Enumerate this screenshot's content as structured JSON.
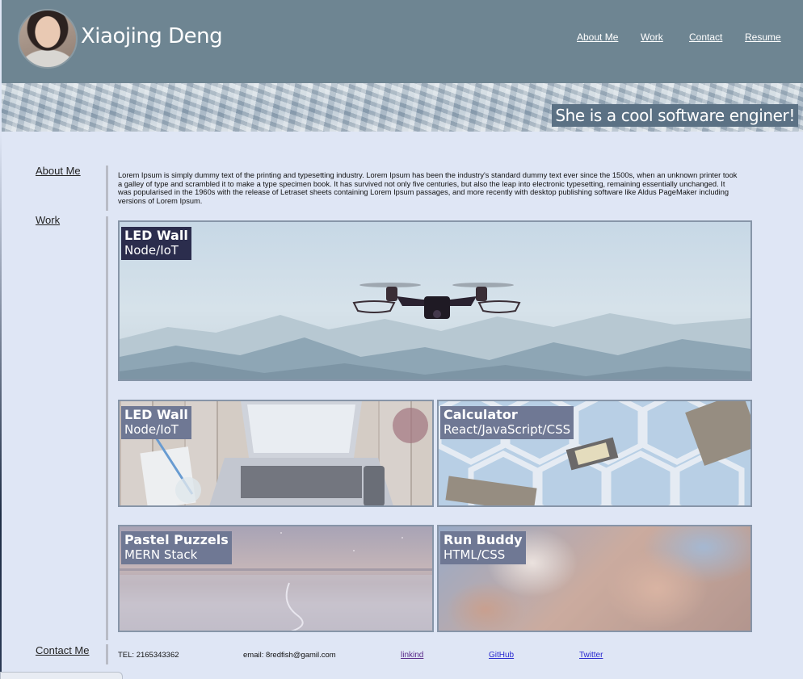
{
  "header": {
    "title": "Xiaojing Deng",
    "nav": [
      "About Me",
      "Work",
      "Contact",
      "Resume"
    ]
  },
  "hero": {
    "tagline": "She is a cool software enginer!"
  },
  "sections": {
    "about_label": "About Me",
    "work_label": "Work",
    "contact_label": "Contact Me"
  },
  "about": {
    "text": "Lorem Ipsum is simply dummy text of the printing and typesetting industry. Lorem Ipsum has been the industry's standard dummy text ever since the 1500s, when an unknown printer took a galley of type and scrambled it to make a type specimen book. It has survived not only five centuries, but also the leap into electronic typesetting, remaining essentially unchanged. It was popularised in the 1960s with the release of Letraset sheets containing Lorem Ipsum passages, and more recently with desktop publishing software like Aldus PageMaker including versions of Lorem Ipsum."
  },
  "projects": [
    {
      "title": "LED Wall",
      "stack": "Node/IoT",
      "label_color": "#2b2d4d",
      "image": "drone-over-mountains"
    },
    {
      "title": "LED Wall",
      "stack": "Node/IoT",
      "label_color": "#6f7894",
      "image": "laptop-on-desk"
    },
    {
      "title": "Calculator",
      "stack": "React/JavaScript/CSS",
      "label_color": "#6f7894",
      "image": "chips-on-hexagons"
    },
    {
      "title": "Pastel Puzzels",
      "stack": "MERN Stack",
      "label_color": "#6f7894",
      "image": "pastel-night-sky"
    },
    {
      "title": "Run Buddy",
      "stack": "HTML/CSS",
      "label_color": "#6f7894",
      "image": "nebula"
    }
  ],
  "footer": {
    "tel": "TEL: 2165343362",
    "email": "email: 8redfish@gamil.com",
    "links": [
      "linkind",
      "GitHub",
      "Twitter"
    ]
  }
}
